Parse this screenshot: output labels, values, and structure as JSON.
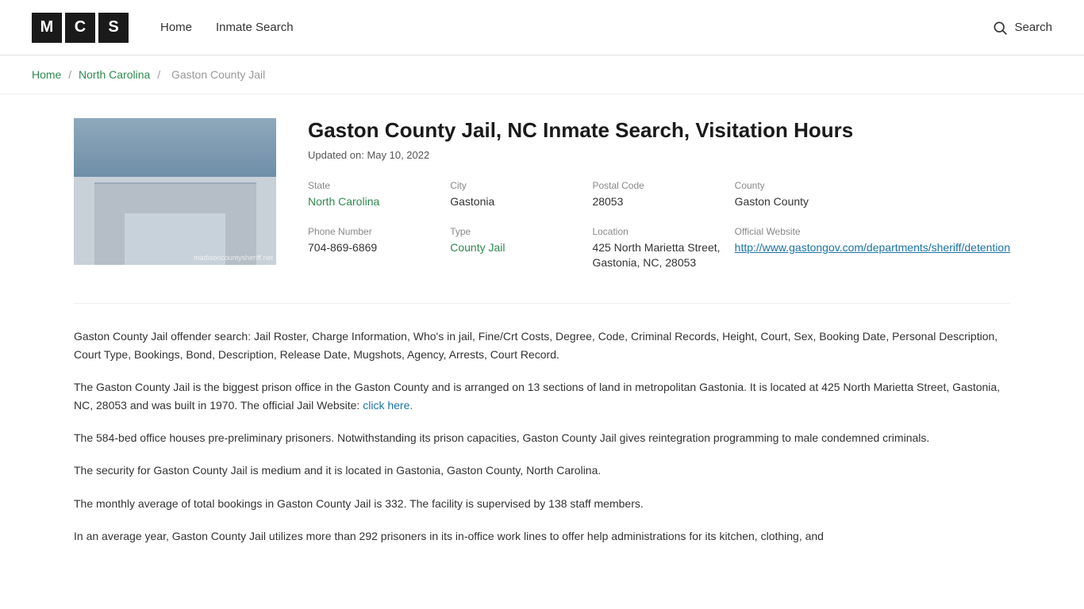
{
  "header": {
    "logo": {
      "m": "M",
      "c": "C",
      "s": "S"
    },
    "nav": [
      {
        "label": "Home",
        "href": "#"
      },
      {
        "label": "Inmate Search",
        "href": "#"
      }
    ],
    "search_label": "Search"
  },
  "breadcrumb": {
    "home": "Home",
    "state": "North Carolina",
    "current": "Gaston County Jail"
  },
  "facility": {
    "title": "Gaston County Jail, NC Inmate Search, Visitation Hours",
    "updated": "Updated on: May 10, 2022",
    "state_label": "State",
    "state_value": "North Carolina",
    "city_label": "City",
    "city_value": "Gastonia",
    "postal_label": "Postal Code",
    "postal_value": "28053",
    "county_label": "County",
    "county_value": "Gaston County",
    "phone_label": "Phone Number",
    "phone_value": "704-869-6869",
    "type_label": "Type",
    "type_value": "County Jail",
    "location_label": "Location",
    "location_value": "425 North Marietta Street, Gastonia, NC, 28053",
    "website_label": "Official Website",
    "website_value": "http://www.gastongov.com/departments/sheriff/detention",
    "watermark": "madisoncountysheriff.net"
  },
  "description": {
    "para1": "Gaston County Jail offender search: Jail Roster, Charge Information, Who's in jail, Fine/Crt Costs, Degree, Code, Criminal Records, Height, Court, Sex, Booking Date, Personal Description, Court Type, Bookings, Bond, Description, Release Date, Mugshots, Agency, Arrests, Court Record.",
    "para2_prefix": "The Gaston County Jail is the biggest prison office in the Gaston County and is arranged on 13 sections of land in metropolitan Gastonia. It is located at 425 North Marietta Street, Gastonia, NC, 28053 and was built in 1970. The official Jail Website:",
    "para2_link": "click here.",
    "para3": "The 584-bed office houses pre-preliminary prisoners. Notwithstanding its prison capacities, Gaston County Jail gives reintegration programming to male condemned criminals.",
    "para4": "The security for Gaston County Jail is medium and it is located in Gastonia, Gaston County, North Carolina.",
    "para5": "The monthly average of total bookings in Gaston County Jail is 332. The facility is supervised by 138 staff members.",
    "para6": "In an average year, Gaston County Jail utilizes more than 292 prisoners in its in-office work lines to offer help administrations for its kitchen, clothing, and"
  }
}
